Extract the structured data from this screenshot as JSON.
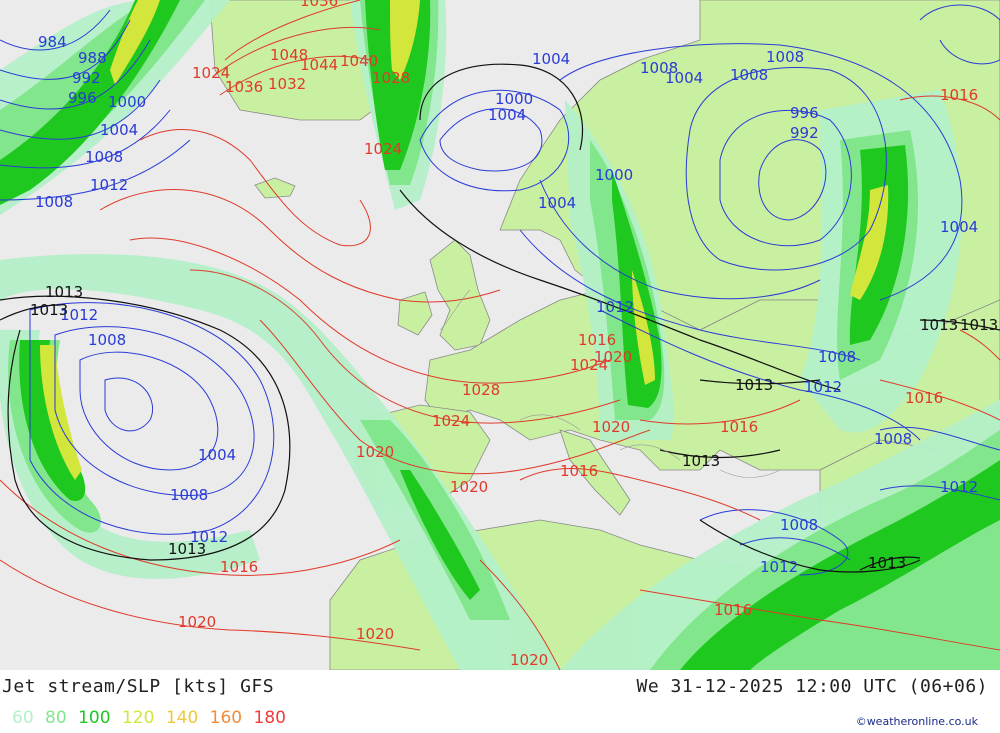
{
  "title": "Jet stream/SLP [kts] GFS",
  "datetime": "We 31-12-2025 12:00 UTC (06+06)",
  "legend": [
    {
      "label": "60",
      "color": "#b4f0c8"
    },
    {
      "label": "80",
      "color": "#82e68c"
    },
    {
      "label": "100",
      "color": "#1ec81e"
    },
    {
      "label": "120",
      "color": "#d2e63c"
    },
    {
      "label": "140",
      "color": "#f0c83c"
    },
    {
      "label": "160",
      "color": "#f08c3c"
    },
    {
      "label": "180",
      "color": "#f03c3c"
    }
  ],
  "credit": "©weatheronline.co.uk",
  "colors": {
    "sea": "#ebebeb",
    "land": "#c8f0a0",
    "isobar_low": "#2a3bd6",
    "isobar_high": "#e03a2a",
    "isobar_1013": "#111111"
  },
  "isobar_labels": {
    "blue": [
      "984",
      "988",
      "992",
      "996",
      "1000",
      "1004",
      "1008",
      "1012",
      "1008",
      "1004",
      "1008",
      "1004",
      "1000",
      "1004",
      "1000",
      "1004",
      "1008",
      "1008",
      "996",
      "992",
      "1004",
      "1012",
      "1012",
      "1008",
      "1004",
      "1008",
      "1012",
      "1008",
      "1012",
      "1008",
      "1012",
      "1008",
      "1012"
    ],
    "red": [
      "1024",
      "1036",
      "1032",
      "1048",
      "1044",
      "1040",
      "1028",
      "1024",
      "1016",
      "1020",
      "1024",
      "1028",
      "1024",
      "1020",
      "1020",
      "1020",
      "1016",
      "1016",
      "1016",
      "1016",
      "1020",
      "1020",
      "1016",
      "1016",
      "1020",
      "1036"
    ],
    "black": [
      "1013",
      "1013",
      "1013",
      "1013",
      "1013",
      "1013",
      "1013",
      "1013"
    ]
  }
}
